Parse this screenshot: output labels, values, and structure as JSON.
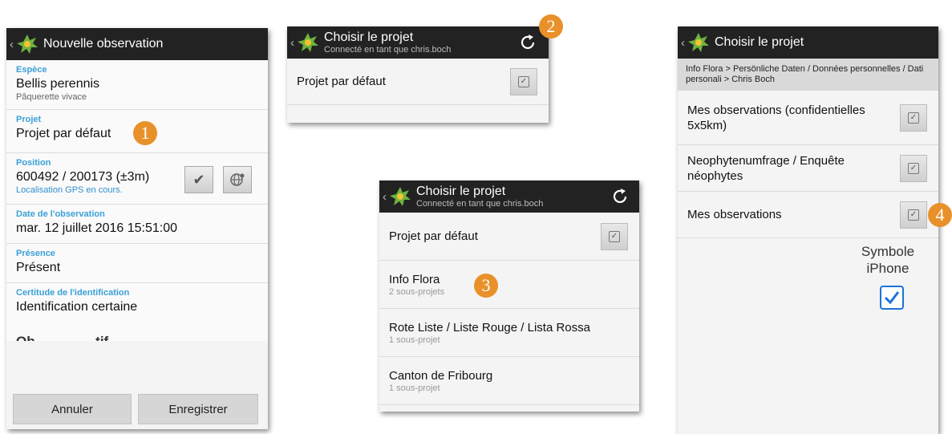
{
  "screen1": {
    "title": "Nouvelle observation",
    "espece": {
      "label": "Espèce",
      "value": "Bellis perennis",
      "sub": "Pâquerette vivace"
    },
    "projet": {
      "label": "Projet",
      "value": "Projet par défaut",
      "badge": "1"
    },
    "position": {
      "label": "Position",
      "value": "600492 / 200173 (±3m)",
      "sub": "Localisation GPS en cours."
    },
    "date": {
      "label": "Date de l'observation",
      "value": "mar. 12 juillet 2016 15:51:00"
    },
    "presence": {
      "label": "Présence",
      "value": "Présent"
    },
    "certitude": {
      "label": "Certitude de l'identification",
      "value": "Identification certaine"
    },
    "cut_text": "Ob                tif",
    "cancel_label": "Annuler",
    "save_label": "Enregistrer"
  },
  "screen2": {
    "title": "Choisir le projet",
    "subtitle": "Connecté en tant que chris.boch",
    "badge": "2",
    "items": [
      {
        "label": "Projet par défaut"
      }
    ]
  },
  "screen3": {
    "title": "Choisir le projet",
    "subtitle": "Connecté en tant que chris.boch",
    "badge": "3",
    "items": [
      {
        "label": "Projet par défaut",
        "sub": ""
      },
      {
        "label": "Info Flora",
        "sub": "2 sous-projets"
      },
      {
        "label": "Rote Liste / Liste Rouge / Lista Rossa",
        "sub": "1 sous-projet"
      },
      {
        "label": "Canton de Fribourg",
        "sub": "1 sous-projet"
      }
    ]
  },
  "screen4": {
    "title": "Choisir le projet",
    "breadcrumb": "Info Flora > Persönliche Daten / Données personnelles / Dati personali > Chris Boch",
    "badge": "4",
    "items": [
      {
        "label": "Mes observations (confidentielles 5x5km)"
      },
      {
        "label": "Neophytenumfrage / Enquête néophytes"
      },
      {
        "label": "Mes observations"
      }
    ],
    "iphone_label_line1": "Symbole",
    "iphone_label_line2": "iPhone"
  },
  "colors": {
    "appbar": "#222222",
    "accent": "#3aa0d8",
    "badge": "#e8912a",
    "iphone_check": "#1a73d8"
  },
  "icons": [
    "back-chevron-icon",
    "app-logo-icon",
    "refresh-icon",
    "check-icon",
    "globe-locate-icon",
    "checkbox-icon"
  ]
}
